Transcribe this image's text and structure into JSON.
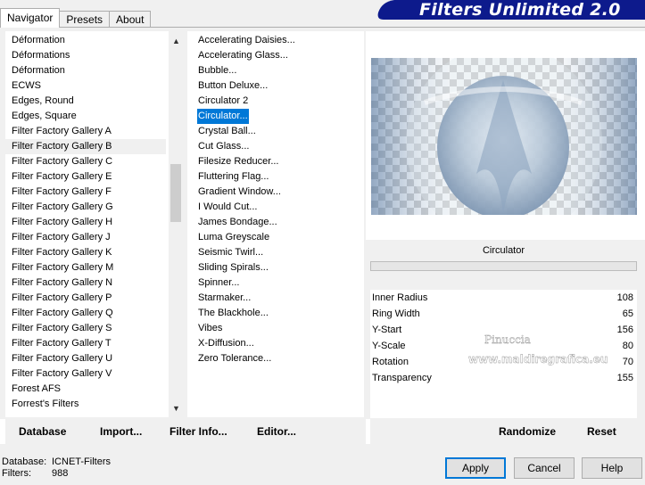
{
  "tabs": [
    {
      "label": "Navigator",
      "active": true
    },
    {
      "label": "Presets",
      "active": false
    },
    {
      "label": "About",
      "active": false
    }
  ],
  "title": "Filters Unlimited 2.0",
  "categories": [
    "Déformation",
    "Déformations",
    "Déformation",
    "ECWS",
    "Edges, Round",
    "Edges, Square",
    "Filter Factory Gallery A",
    "Filter Factory Gallery B",
    "Filter Factory Gallery C",
    "Filter Factory Gallery E",
    "Filter Factory Gallery F",
    "Filter Factory Gallery G",
    "Filter Factory Gallery H",
    "Filter Factory Gallery J",
    "Filter Factory Gallery K",
    "Filter Factory Gallery M",
    "Filter Factory Gallery N",
    "Filter Factory Gallery P",
    "Filter Factory Gallery Q",
    "Filter Factory Gallery S",
    "Filter Factory Gallery T",
    "Filter Factory Gallery U",
    "Filter Factory Gallery V",
    "Forest AFS",
    "Forrest's Filters"
  ],
  "selected_category": "Filter Factory Gallery B",
  "filters": [
    "Accelerating Daisies...",
    "Accelerating Glass...",
    "Bubble...",
    "Button Deluxe...",
    "Circulator 2",
    "Circulator...",
    "Crystal Ball...",
    "Cut Glass...",
    "Filesize Reducer...",
    "Fluttering Flag...",
    "Gradient Window...",
    "I Would Cut...",
    "James Bondage...",
    "Luma Greyscale",
    "Seismic Twirl...",
    "Sliding Spirals...",
    "Spinner...",
    "Starmaker...",
    "The Blackhole...",
    "Vibes",
    "X-Diffusion...",
    "Zero Tolerance..."
  ],
  "selected_filter": "Circulator...",
  "preview_filter_name": "Circulator",
  "params": [
    {
      "name": "Inner Radius",
      "value": "108"
    },
    {
      "name": "Ring Width",
      "value": "65"
    },
    {
      "name": "Y-Start",
      "value": "156"
    },
    {
      "name": "Y-Scale",
      "value": "80"
    },
    {
      "name": "Rotation",
      "value": "70"
    },
    {
      "name": "Transparency",
      "value": "155"
    }
  ],
  "watermark": {
    "name": "Pinuccia",
    "url": "www.maldiregrafica.eu"
  },
  "bottom_buttons": {
    "database": "Database",
    "import": "Import...",
    "filter_info": "Filter Info...",
    "editor": "Editor...",
    "randomize": "Randomize",
    "reset": "Reset"
  },
  "status": {
    "database_label": "Database:",
    "database_value": "ICNET-Filters",
    "filters_label": "Filters:",
    "filters_value": "988"
  },
  "dialog": {
    "apply": "Apply",
    "cancel": "Cancel",
    "help": "Help"
  },
  "colors": {
    "accent": "#0078d7",
    "banner": "#0d1a8c"
  }
}
